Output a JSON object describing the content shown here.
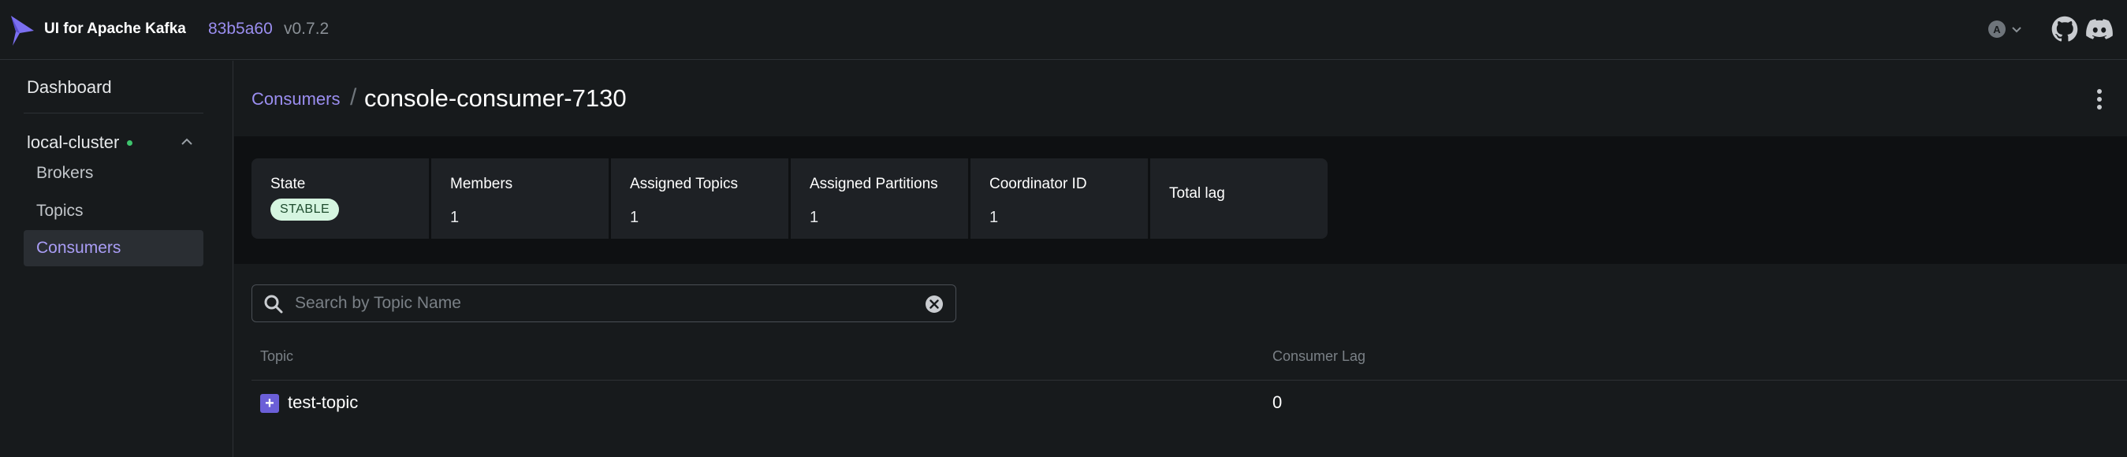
{
  "navbar": {
    "app_title": "UI for Apache Kafka",
    "version_hash": "83b5a60",
    "version_tag": "v0.7.2",
    "theme_icon_letter": "A",
    "icons": [
      "logo-icon",
      "theme-icon",
      "chevron-down-icon",
      "github-icon",
      "discord-icon"
    ]
  },
  "sidebar": {
    "dashboard": "Dashboard",
    "cluster_name": "local-cluster",
    "cluster_status_color": "#3ec46d",
    "items": [
      {
        "label": "Brokers",
        "active": false
      },
      {
        "label": "Topics",
        "active": false
      },
      {
        "label": "Consumers",
        "active": true
      }
    ]
  },
  "page": {
    "breadcrumb_parent": "Consumers",
    "breadcrumb_separator": "/",
    "title": "console-consumer-7130"
  },
  "metrics": {
    "state_label": "State",
    "state_value": "STABLE",
    "members_label": "Members",
    "members_value": "1",
    "assigned_topics_label": "Assigned Topics",
    "assigned_topics_value": "1",
    "assigned_partitions_label": "Assigned Partitions",
    "assigned_partitions_value": "1",
    "coordinator_label": "Coordinator ID",
    "coordinator_value": "1",
    "total_lag_label": "Total lag",
    "total_lag_value": ""
  },
  "search": {
    "placeholder": "Search by Topic Name",
    "value": ""
  },
  "table": {
    "columns": [
      "Topic",
      "Consumer Lag"
    ],
    "rows": [
      {
        "topic": "test-topic",
        "lag": "0"
      }
    ]
  },
  "colors": {
    "accent": "#9b8ef0",
    "background": "#171a1c",
    "badge_bg": "#d5f5e0"
  }
}
